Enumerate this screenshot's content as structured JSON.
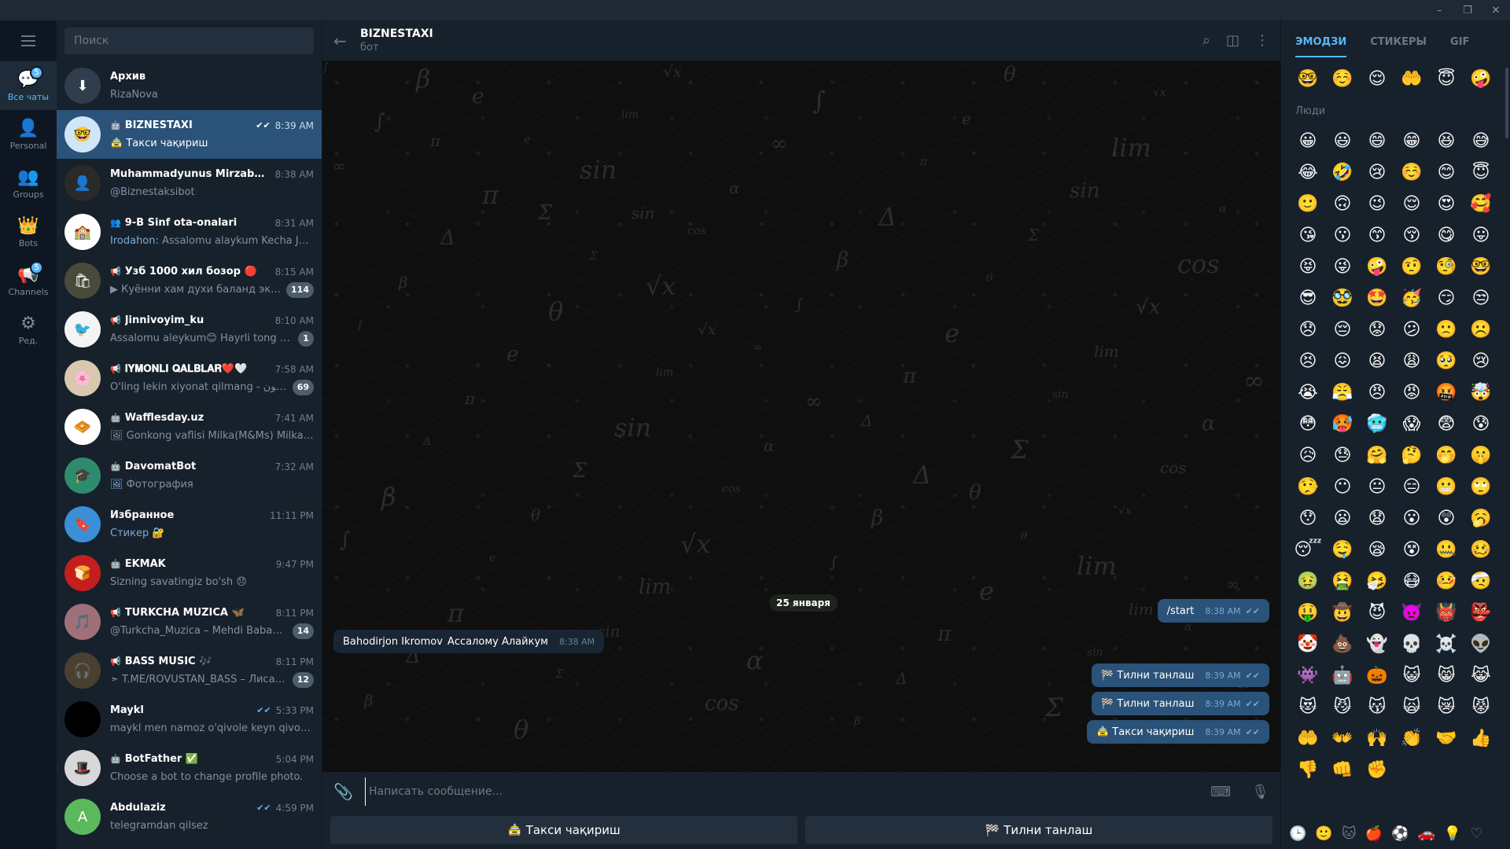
{
  "window": {
    "controls": [
      "–",
      "❐",
      "✕"
    ]
  },
  "folders": {
    "items": [
      {
        "label": "Все чаты",
        "badge": "5",
        "icon": "chats-icon"
      },
      {
        "label": "Personal",
        "badge": "",
        "icon": "person-icon"
      },
      {
        "label": "Groups",
        "badge": "",
        "icon": "group-icon"
      },
      {
        "label": "Bots",
        "badge": "",
        "icon": "bot-crown-icon"
      },
      {
        "label": "Channels",
        "badge": "5",
        "icon": "channel-icon"
      },
      {
        "label": "Ред.",
        "badge": "",
        "icon": "edit-sliders-icon"
      }
    ]
  },
  "search": {
    "placeholder": "Поиск"
  },
  "chats": [
    {
      "name": "Архив",
      "time": "",
      "preview": "RizaNova",
      "prefix": "",
      "unread": "",
      "checks": "",
      "type": "",
      "avatar_color": "#2f3d4d",
      "avatar_text": "⬇"
    },
    {
      "name": "BIZNESTAXI",
      "time": "8:39 AM",
      "preview": "🚖 Такси чақириш",
      "prefix": "",
      "unread": "",
      "checks": "✔✔",
      "type": "🤖",
      "avatar_color": "#cfe6f7",
      "avatar_text": "🤓"
    },
    {
      "name": "Muhammadyunus Mirzabadalov",
      "time": "8:38 AM",
      "preview": "@Biznestaksibot",
      "prefix": "",
      "unread": "",
      "checks": "",
      "type": "",
      "avatar_color": "#2a2a2a",
      "avatar_text": "👤"
    },
    {
      "name": "9-B Sinf ota-onalari",
      "time": "8:31 AM",
      "preview": "Assalomu alaykum  Kecha  Jora...",
      "prefix": "Irodahon: ",
      "unread": "",
      "checks": "",
      "type": "👥",
      "avatar_color": "#ffffff",
      "avatar_text": "🏫"
    },
    {
      "name": "Узб 1000 хил бозор 🔴",
      "time": "8:15 AM",
      "preview": "▶ Куённи хам духи баланд экану ...",
      "prefix": "",
      "unread": "114",
      "checks": "",
      "type": "📢",
      "avatar_color": "#4a4a3a",
      "avatar_text": "🛍"
    },
    {
      "name": "Jinnivoyim_ku",
      "time": "8:10 AM",
      "preview": "Assalomu aleykum😊 Hayrli tong ha...",
      "prefix": "",
      "unread": "1",
      "checks": "",
      "type": "📢",
      "avatar_color": "#f4f4f4",
      "avatar_text": "🐦"
    },
    {
      "name": "𝐈𝐘𝐌𝐎𝐍𝐋𝐈 𝐐𝐀𝐋𝐁𝐋𝐀𝐑❤️🤍",
      "time": "7:58 AM",
      "preview": "O'ling lekin xiyonat qilmang - لا تخون",
      "prefix": "",
      "unread": "69",
      "checks": "",
      "type": "📢",
      "avatar_color": "#d9c7b0",
      "avatar_text": "🌸"
    },
    {
      "name": "Wafflesday.uz",
      "time": "7:41 AM",
      "preview": "🖼 Gonkong vaflisi Milka(M&Ms)  Milka(M...",
      "prefix": "",
      "unread": "",
      "checks": "",
      "type": "🤖",
      "avatar_color": "#ffffff",
      "avatar_text": "🧇"
    },
    {
      "name": "DavomatBot",
      "time": "7:32 AM",
      "preview": "Фотография",
      "prefix": "🖼 ",
      "unread": "",
      "checks": "",
      "type": "🤖",
      "avatar_color": "#2e8b6e",
      "avatar_text": "🎓"
    },
    {
      "name": "Избранное",
      "time": "11:11 PM",
      "preview": "🔐",
      "prefix": "Стикер ",
      "unread": "",
      "checks": "",
      "type": "",
      "avatar_color": "#3a8fd6",
      "avatar_text": "🔖"
    },
    {
      "name": "EKMAK",
      "time": "9:47 PM",
      "preview": "Sizning savatingiz bo'sh 😞",
      "prefix": "",
      "unread": "",
      "checks": "",
      "type": "🤖",
      "avatar_color": "#c41e1e",
      "avatar_text": "🍞"
    },
    {
      "name": "TURKCHA MUZICA 🦋",
      "time": "8:11 PM",
      "preview": "@Turkcha_Muzica – Mehdi Babazade...",
      "prefix": "",
      "unread": "14",
      "checks": "",
      "type": "📢",
      "avatar_color": "#a0707a",
      "avatar_text": "🎵"
    },
    {
      "name": "BASS MUSIC 🎶",
      "time": "8:11 PM",
      "preview": "➣ T.ME/ROVUSTAN_BASS – Лиса, #B...",
      "prefix": "",
      "unread": "12",
      "checks": "",
      "type": "📢",
      "avatar_color": "#4a4030",
      "avatar_text": "🎧"
    },
    {
      "name": "Maykl",
      "time": "5:33 PM",
      "preview": "maykl men namoz o'qivole keyn qivoraman",
      "prefix": "",
      "unread": "",
      "checks": "✔✔",
      "type": "",
      "avatar_color": "#000000",
      "avatar_text": ""
    },
    {
      "name": "BotFather ✅",
      "time": "5:04 PM",
      "preview": "Choose a bot to change profile photo.",
      "prefix": "",
      "unread": "",
      "checks": "",
      "type": "🤖",
      "avatar_color": "#d8d8d8",
      "avatar_text": "🎩"
    },
    {
      "name": "Abdulaziz",
      "time": "4:59 PM",
      "preview": "telegramdan qilsez",
      "prefix": "",
      "unread": "",
      "checks": "✔✔",
      "type": "",
      "avatar_color": "#5cb85c",
      "avatar_text": "A"
    }
  ],
  "header": {
    "title": "BIZNESTAXI",
    "subtitle": "бот"
  },
  "conversation": {
    "date": "25 января",
    "messages": [
      {
        "dir": "out",
        "text": "/start",
        "time": "8:38 AM",
        "checks": "✔✔"
      },
      {
        "dir": "in",
        "sender": "Bahodirjon Ikromov",
        "text": "Ассалому Алайкум",
        "time": "8:38 AM",
        "checks": ""
      },
      {
        "dir": "out",
        "text": "🏁 Тилни танлаш",
        "time": "8:39 AM",
        "checks": "✔✔"
      },
      {
        "dir": "out",
        "text": "🏁 Тилни танлаш",
        "time": "8:39 AM",
        "checks": "✔✔"
      },
      {
        "dir": "out",
        "text": "🚖 Такси чақириш",
        "time": "8:39 AM",
        "checks": "✔✔"
      }
    ]
  },
  "composer": {
    "placeholder": "Написать сообщение..."
  },
  "keyboard": {
    "buttons": [
      "🚖 Такси чақириш",
      "🏁 Тилни танлаш"
    ]
  },
  "emoji_panel": {
    "tabs": [
      "ЭМОДЗИ",
      "СТИКЕРЫ",
      "GIF"
    ],
    "recent": [
      "🤓",
      "☺️",
      "😌",
      "🤲",
      "😇",
      "🤪"
    ],
    "category": "Люди",
    "emojis": [
      "😀",
      "😃",
      "😄",
      "😁",
      "😆",
      "😅",
      "😂",
      "🤣",
      "😢",
      "☺️",
      "😊",
      "😇",
      "🙂",
      "🙃",
      "😉",
      "😌",
      "😍",
      "🥰",
      "😘",
      "😗",
      "😙",
      "😚",
      "😋",
      "😛",
      "😝",
      "😜",
      "🤪",
      "🤨",
      "🧐",
      "🤓",
      "😎",
      "🥸",
      "🤩",
      "🥳",
      "😏",
      "😒",
      "😞",
      "😔",
      "😟",
      "😕",
      "🙁",
      "☹️",
      "😣",
      "😖",
      "😫",
      "😩",
      "🥺",
      "😢",
      "😭",
      "😤",
      "😠",
      "😡",
      "🤬",
      "🤯",
      "😳",
      "🥵",
      "🥶",
      "😱",
      "😨",
      "😰",
      "😥",
      "😓",
      "🤗",
      "🤔",
      "🤭",
      "🤫",
      "🤥",
      "😶",
      "😐",
      "😑",
      "😬",
      "🙄",
      "😯",
      "😦",
      "😧",
      "😮",
      "😲",
      "🥱",
      "😴",
      "🤤",
      "😪",
      "😵",
      "🤐",
      "🥴",
      "🤢",
      "🤮",
      "🤧",
      "😷",
      "🤒",
      "🤕",
      "🤑",
      "🤠",
      "😈",
      "👿",
      "👹",
      "👺",
      "🤡",
      "💩",
      "👻",
      "💀",
      "☠️",
      "👽",
      "👾",
      "🤖",
      "🎃",
      "😺",
      "😸",
      "😹",
      "😻",
      "😼",
      "😽",
      "🙀",
      "😿",
      "😾",
      "🤲",
      "👐",
      "🙌",
      "👏",
      "🤝",
      "👍",
      "👎",
      "👊",
      "✊"
    ],
    "footer_icons": [
      "🕒",
      "🙂",
      "🐱",
      "🍎",
      "⚽",
      "🚗",
      "💡",
      "♡"
    ]
  }
}
